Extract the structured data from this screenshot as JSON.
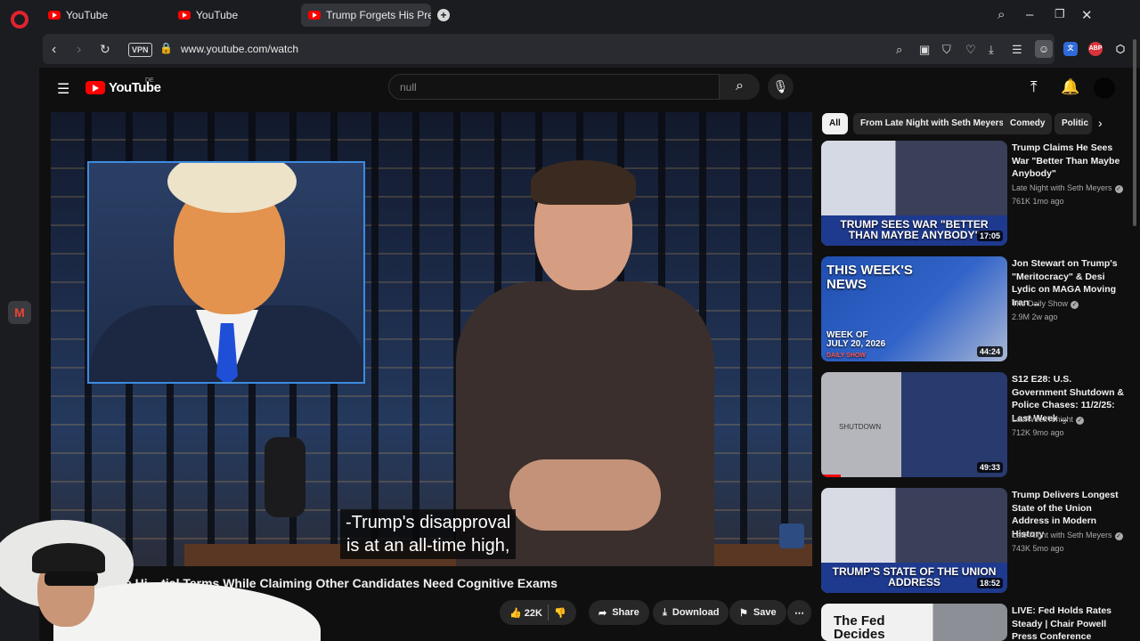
{
  "browser": {
    "tabs": [
      {
        "label": "YouTube"
      },
      {
        "label": "YouTube"
      },
      {
        "label": "Trump Forgets His Pre"
      }
    ],
    "new_tab": "+",
    "vpn": "VPN",
    "url": "www.youtube.com/watch",
    "ext_abp": "ABP",
    "sidebar_app": "M"
  },
  "youtube": {
    "logo_text": "YouTube",
    "country": "DE",
    "search_placeholder": "null"
  },
  "player": {
    "caption_line1": "-Trump's disapproval",
    "caption_line2": "is at an all-time high,"
  },
  "video": {
    "title": "e Hi... tial Terms While Claiming Other Candidates Need Cognitive Exams",
    "likes": "22K",
    "share": "Share",
    "download": "Download",
    "save": "Save"
  },
  "chips": [
    {
      "label": "All"
    },
    {
      "label": "From Late Night with Seth Meyers"
    },
    {
      "label": "Comedy"
    },
    {
      "label": "Politic"
    }
  ],
  "recommendations": [
    {
      "title": "Trump Claims He Sees War \"Better Than Maybe Anybody\"",
      "channel": "Late Night with Seth Meyers",
      "meta": "761K  1mo ago",
      "duration": "17:05",
      "thumb_text": "TRUMP SEES WAR \"BETTER THAN MAYBE ANYBODY\""
    },
    {
      "title": "Jon Stewart on Trump's \"Meritocracy\" & Desi Lydic on MAGA Moving Iran ...",
      "channel": "The Daily Show",
      "meta": "2.9M  2w ago",
      "duration": "44:24",
      "thumb_text": "THIS WEEK'S NEWS",
      "thumb_sub": "WEEK OF JULY 20, 2026",
      "thumb_brand": "DAILY SHOW"
    },
    {
      "title": "S12 E28: U.S. Government Shutdown & Police Chases: 11/2/25: Last Week ...",
      "channel": "LastWeekTonight",
      "meta": "712K  9mo ago",
      "duration": "49:33",
      "thumb_text": "SHUTDOWN"
    },
    {
      "title": "Trump Delivers Longest State of the Union Address in Modern History",
      "channel": "Late Night with Seth Meyers",
      "meta": "743K  5mo ago",
      "duration": "18:52",
      "thumb_text": "TRUMP'S STATE OF THE UNION ADDRESS"
    },
    {
      "title": "LIVE: Fed Holds Rates Steady | Chair Powell Press Conference",
      "thumb_text": "The Fed Decides"
    }
  ]
}
